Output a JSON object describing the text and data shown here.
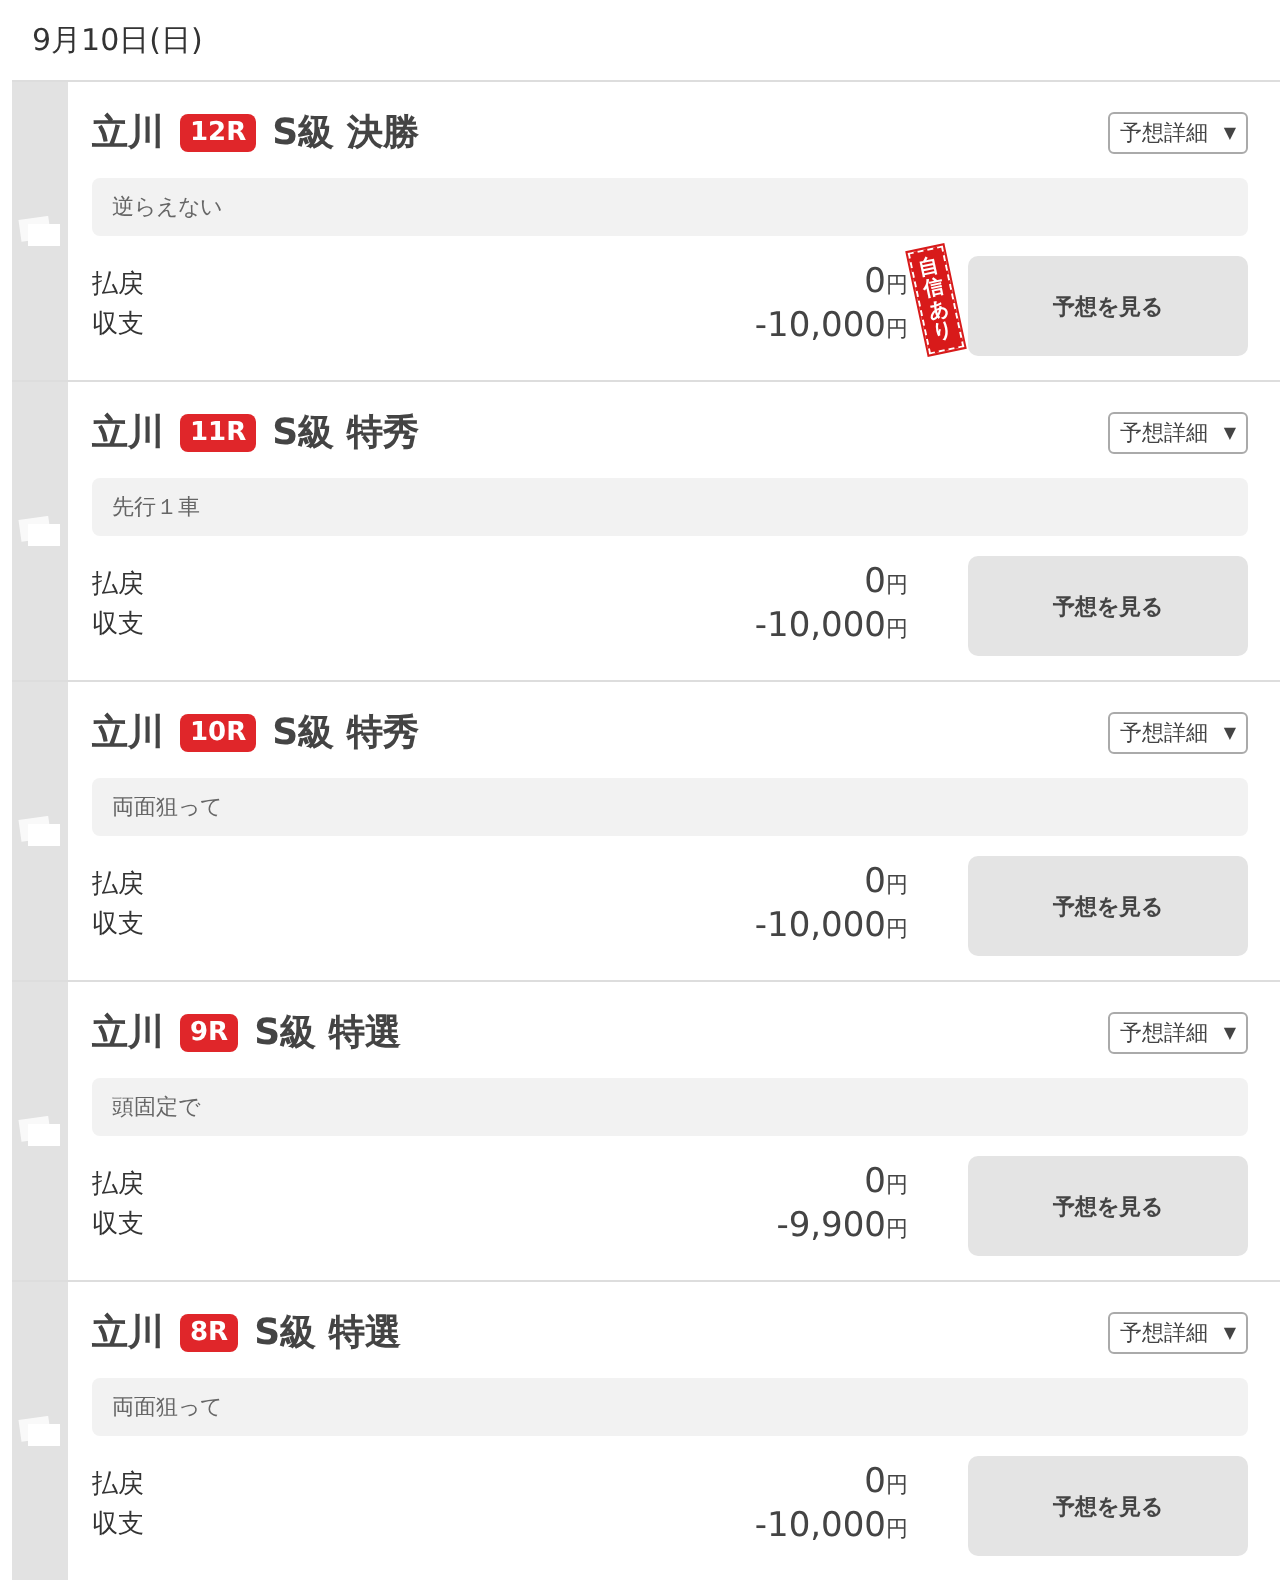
{
  "date": "9月10日(日)",
  "races": [
    {
      "venue": "立川",
      "race": "12R",
      "grade": "S級 決勝",
      "detail": "予想詳細",
      "arrow": "▼",
      "memo": "逆らえない",
      "payout_label": "払戻",
      "payout": "0",
      "balance_label": "収支",
      "balance": "-10,000",
      "payout_yen": "円",
      "balance_yen": "円",
      "button": "予想を見る",
      "stamp": "自信あり"
    },
    {
      "venue": "立川",
      "race": "11R",
      "grade": "S級 特秀",
      "detail": "予想詳細",
      "arrow": "▼",
      "memo": "先行１車",
      "payout_label": "払戻",
      "payout": "0",
      "balance_label": "収支",
      "balance": "-10,000",
      "payout_yen": "円",
      "balance_yen": "円",
      "button": "予想を見る"
    },
    {
      "venue": "立川",
      "race": "10R",
      "grade": "S級 特秀",
      "detail": "予想詳細",
      "arrow": "▼",
      "memo": "両面狙って",
      "payout_label": "払戻",
      "payout": "0",
      "balance_label": "収支",
      "balance": "-10,000",
      "payout_yen": "円",
      "balance_yen": "円",
      "button": "予想を見る"
    },
    {
      "venue": "立川",
      "race": "9R",
      "grade": "S級 特選",
      "detail": "予想詳細",
      "arrow": "▼",
      "memo": "頭固定で",
      "payout_label": "払戻",
      "payout": "0",
      "balance_label": "収支",
      "balance": "-9,900",
      "payout_yen": "円",
      "balance_yen": "円",
      "button": "予想を見る"
    },
    {
      "venue": "立川",
      "race": "8R",
      "grade": "S級 特選",
      "detail": "予想詳細",
      "arrow": "▼",
      "memo": "両面狙って",
      "payout_label": "払戻",
      "payout": "0",
      "balance_label": "収支",
      "balance": "-10,000",
      "payout_yen": "円",
      "balance_yen": "円",
      "button": "予想を見る"
    }
  ]
}
